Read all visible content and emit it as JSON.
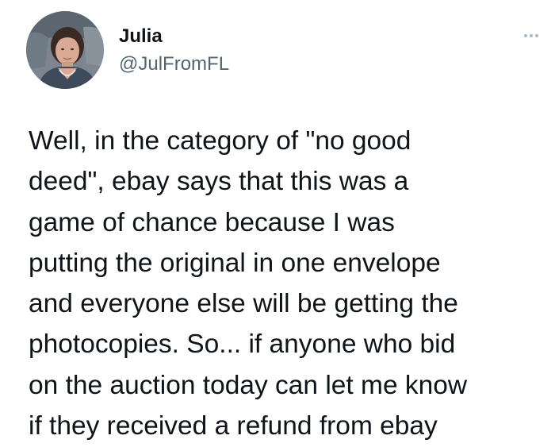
{
  "tweet": {
    "author": {
      "name": "Julia",
      "handle": "@JulFromFL",
      "avatar_icon": "profile-photo"
    },
    "more_icon": "more-horizontal-icon",
    "text_lines": [
      "Well, in the category of \"no good",
      "deed\", ebay says that this was a",
      "game of chance because I was",
      "putting the original in one envelope",
      "and everyone else will be getting the",
      "photocopies. So... if anyone who bid",
      "on the auction today can let me know",
      "if they received a refund from ebay"
    ]
  },
  "colors": {
    "text": "#0f1419",
    "secondary_text": "#536471",
    "more_dots": "#aab8c2",
    "background": "#ffffff"
  }
}
